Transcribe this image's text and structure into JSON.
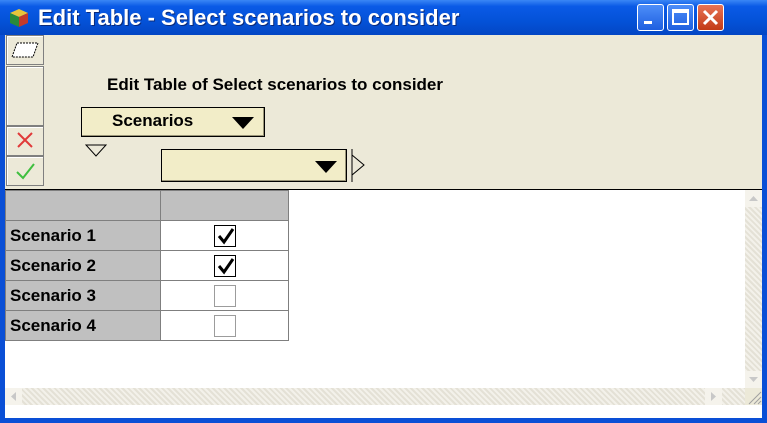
{
  "window": {
    "title": "Edit Table - Select scenarios to consider",
    "title_color": "#ffffff",
    "titlebar_color": "#0a5ae6"
  },
  "toolbar": {
    "edit_icon": "edit-parallelogram-icon",
    "cancel_icon": "red-x-icon",
    "ok_icon": "green-check-icon"
  },
  "heading": "Edit Table of Select scenarios to consider",
  "index_menu": {
    "label": "Scenarios"
  },
  "cell_selector": {
    "value": ""
  },
  "table": {
    "column_header": "",
    "rows": [
      {
        "label": "Scenario 1",
        "checked": true
      },
      {
        "label": "Scenario 2",
        "checked": true
      },
      {
        "label": "Scenario 3",
        "checked": false
      },
      {
        "label": "Scenario 4",
        "checked": false
      }
    ]
  },
  "colors": {
    "menu_bg": "#f2edc8",
    "header_gray": "#c0c0c0",
    "client_bg": "#ece9d8"
  }
}
